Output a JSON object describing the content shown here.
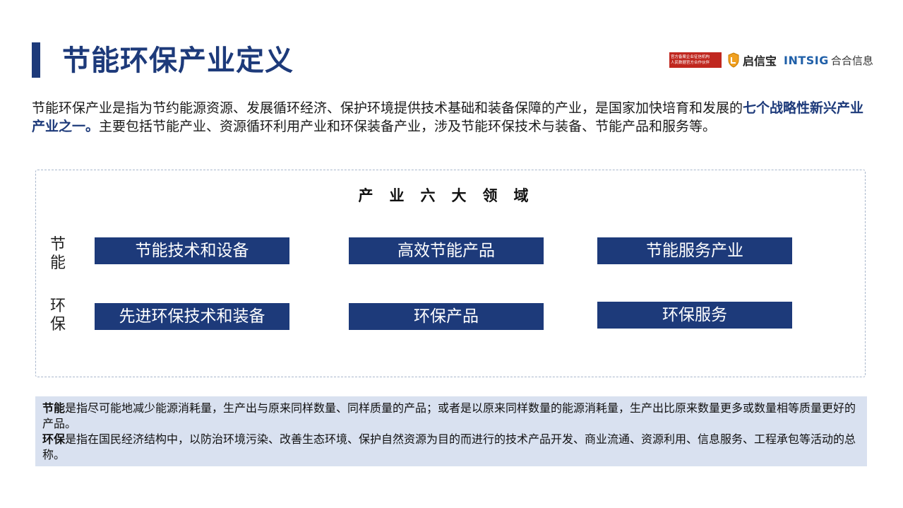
{
  "header": {
    "title": "节能环保产业定义"
  },
  "logos": {
    "red_badge_line1": "官方备案企业征信机构",
    "red_badge_line2": "人民数据官方合作伙伴",
    "qixinbao": "启信宝",
    "intsig": "INTSIG",
    "hehe": "合合信息"
  },
  "intro": {
    "part1": "节能环保产业是指为节约能源资源、发展循环经济、保护环境提供技术基础和装备保障的产业，是国家加快培育和发展的",
    "highlight": "七个战略性新兴产业产业之一。",
    "part2": "主要包括节能产业、资源循环利用产业和环保装备产业，涉及节能环保技术与装备、节能产品和服务等。"
  },
  "panel": {
    "title": "产业六大领域",
    "rows": [
      {
        "label": "节能",
        "boxes": [
          "节能技术和设备",
          "高效节能产品",
          "节能服务产业"
        ]
      },
      {
        "label": "环保",
        "boxes": [
          "先进环保技术和装备",
          "环保产品",
          "环保服务"
        ]
      }
    ]
  },
  "definitions": {
    "energy_term": "节能",
    "energy_text": "是指尽可能地减少能源消耗量，生产出与原来同样数量、同样质量的产品；或者是以原来同样数量的能源消耗量，生产出比原来数量更多或数量相等质量更好的产品。",
    "env_term": "环保",
    "env_text": "是指在国民经济结构中，以防治环境污染、改善生态环境、保护自然资源为目的而进行的技术产品开发、商业流通、资源利用、信息服务、工程承包等活动的总称。"
  },
  "colors": {
    "primary": "#1d3a7a",
    "defs_bg": "#d9e1f0",
    "logo_red": "#c0271f",
    "intsig_blue": "#1f5fa8"
  }
}
